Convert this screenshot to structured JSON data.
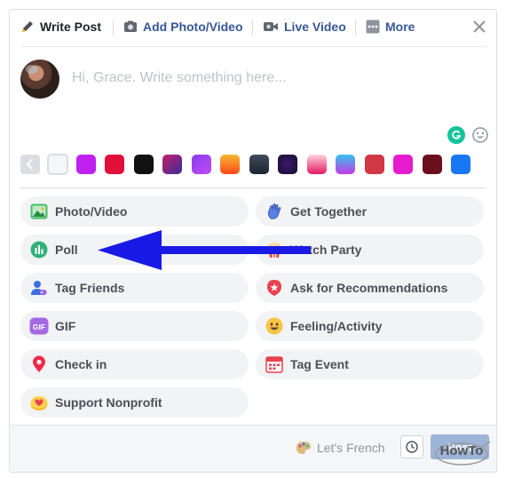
{
  "header": {
    "tabs": [
      {
        "label": "Write Post",
        "icon": "pencil-icon",
        "active": true
      },
      {
        "label": "Add Photo/Video",
        "icon": "camera-icon"
      },
      {
        "label": "Live Video",
        "icon": "video-camera-icon"
      },
      {
        "label": "More",
        "icon": "more-dots-icon"
      }
    ],
    "close_icon": "close-icon"
  },
  "composer": {
    "placeholder": "Hi, Grace. Write something here...",
    "value": ""
  },
  "swatches": {
    "colors": [
      "#f5f6f7",
      "#c020f0",
      "#e0103a",
      "#111111",
      "linear-gradient(135deg,#c21f6b,#3b2c9a)",
      "linear-gradient(135deg,#8a3cf0,#c04cf5)",
      "linear-gradient(180deg,#f7b733,#fc4a1a)",
      "linear-gradient(180deg,#414d5b,#1c2430)",
      "radial-gradient(circle,#3b1b6b,#1a0b33)",
      "linear-gradient(180deg,#ffd1dc,#e6195e)",
      "linear-gradient(180deg,#36c2ee,#c23be6)",
      "#d23744",
      "#e51ccd",
      "#6b0f1e",
      "#1877f2"
    ],
    "selected_index": 0
  },
  "options": [
    {
      "label": "Photo/Video",
      "icon": "photo-icon",
      "col": 1,
      "row": 0
    },
    {
      "label": "Get Together",
      "icon": "hand-wave-icon",
      "col": 2,
      "row": 0
    },
    {
      "label": "Poll",
      "icon": "poll-icon",
      "col": 1,
      "row": 1
    },
    {
      "label": "Watch Party",
      "icon": "popcorn-icon",
      "col": 2,
      "row": 1
    },
    {
      "label": "Tag Friends",
      "icon": "tag-friends-icon",
      "col": 1,
      "row": 2
    },
    {
      "label": "Ask for Recommendations",
      "icon": "recommendation-star-icon",
      "col": 2,
      "row": 2
    },
    {
      "label": "GIF",
      "icon": "gif-icon",
      "col": 1,
      "row": 3
    },
    {
      "label": "Feeling/Activity",
      "icon": "smiley-icon",
      "col": 2,
      "row": 3
    },
    {
      "label": "Check in",
      "icon": "location-pin-icon",
      "col": 1,
      "row": 4
    },
    {
      "label": "Tag Event",
      "icon": "calendar-icon",
      "col": 2,
      "row": 4
    },
    {
      "label": "Support Nonprofit",
      "icon": "heart-coin-icon",
      "col": 1,
      "row": 5
    }
  ],
  "footer": {
    "language_label": "Let's French",
    "post_label": "Post"
  },
  "watermark": {
    "text": "HowTo"
  },
  "colors": {
    "link": "#365899",
    "arrow": "#1a1ae6",
    "pill_bg": "#f2f3f5",
    "post_disabled": "#9cb4d8"
  }
}
